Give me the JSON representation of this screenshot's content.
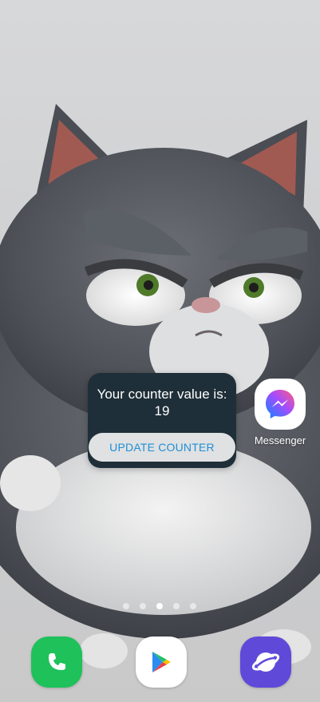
{
  "widget": {
    "message": "Your counter value is:",
    "value": "19",
    "button_label": "UPDATE COUNTER"
  },
  "apps": {
    "messenger": {
      "label": "Messenger",
      "icon": "messenger-icon"
    }
  },
  "page_indicator": {
    "count": 5,
    "active_index": 2
  },
  "dock": [
    {
      "name": "phone",
      "icon": "phone-icon",
      "color": "#1fc15a"
    },
    {
      "name": "play-store",
      "icon": "play-store-icon",
      "color": "#ffffff"
    },
    {
      "name": "internet",
      "icon": "internet-icon",
      "color": "#5f49d9"
    }
  ],
  "colors": {
    "widget_background": "#1f2f39",
    "button_text": "#1f8fd7"
  }
}
